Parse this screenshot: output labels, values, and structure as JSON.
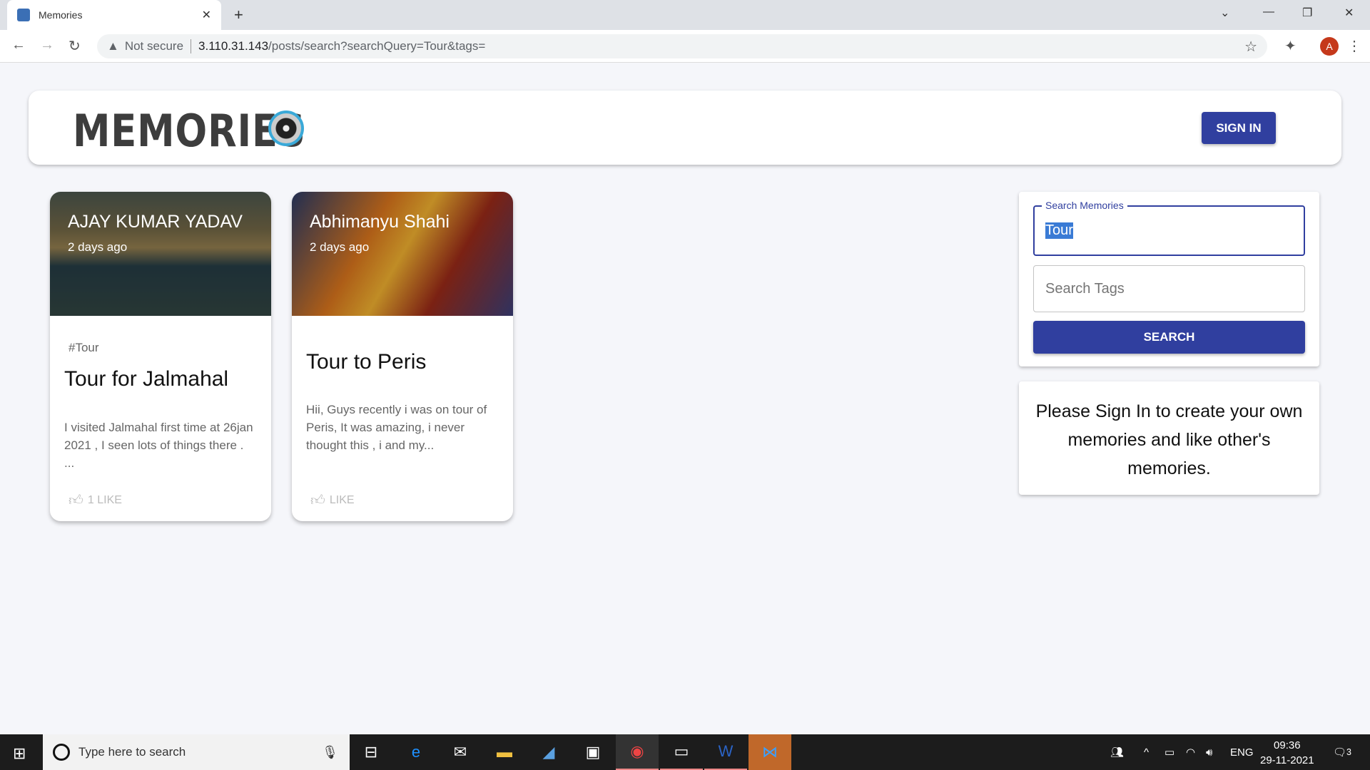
{
  "browser": {
    "tab_title": "Memories",
    "security": "Not secure",
    "url_host": "3.110.31.143",
    "url_path": "/posts/search?searchQuery=Tour&tags=",
    "profile_initial": "A"
  },
  "app": {
    "logo": "MEMORIES",
    "sign_in": "SIGN IN"
  },
  "posts": [
    {
      "author": "AJAY KUMAR YADAV",
      "time": "2 days ago",
      "tags": "#Tour",
      "title": "Tour for Jalmahal",
      "message": "I visited Jalmahal first time at 26jan 2021 , I seen lots of things there . ...",
      "likes": "1 LIKE"
    },
    {
      "author": "Abhimanyu Shahi",
      "time": "2 days ago",
      "tags": "",
      "title": "Tour to Peris",
      "message": "Hii, Guys recently i was on tour of Peris, It was amazing, i never thought this , i and my...",
      "likes": "LIKE"
    }
  ],
  "search": {
    "label": "Search Memories",
    "value": "Tour",
    "tags_placeholder": "Search Tags",
    "button": "SEARCH"
  },
  "notice": "Please Sign In to create your own memories and like other's memories.",
  "taskbar": {
    "search_placeholder": "Type here to search",
    "lang": "ENG",
    "time": "09:36",
    "date": "29-11-2021",
    "notifications": "3"
  },
  "colors": {
    "primary": "#303f9f",
    "background": "#f5f6fa"
  }
}
